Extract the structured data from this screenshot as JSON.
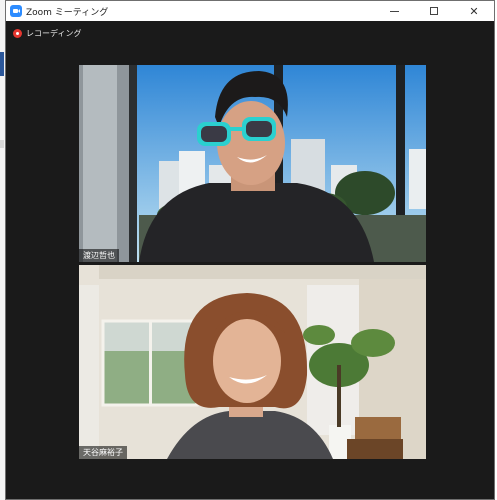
{
  "window": {
    "title": "Zoom ミーティング",
    "app_icon": "zoom-camera-icon",
    "controls": [
      "minimize-icon",
      "maximize-icon",
      "close-icon"
    ]
  },
  "recording": {
    "label": "レコーディング",
    "icon": "record-dot-icon",
    "color": "#e5362f"
  },
  "participants": [
    {
      "name": "渡辺哲也"
    },
    {
      "name": "天谷麻裕子"
    }
  ],
  "colors": {
    "meeting_background": "#1a1a1a",
    "zoom_blue": "#2d8cff"
  }
}
